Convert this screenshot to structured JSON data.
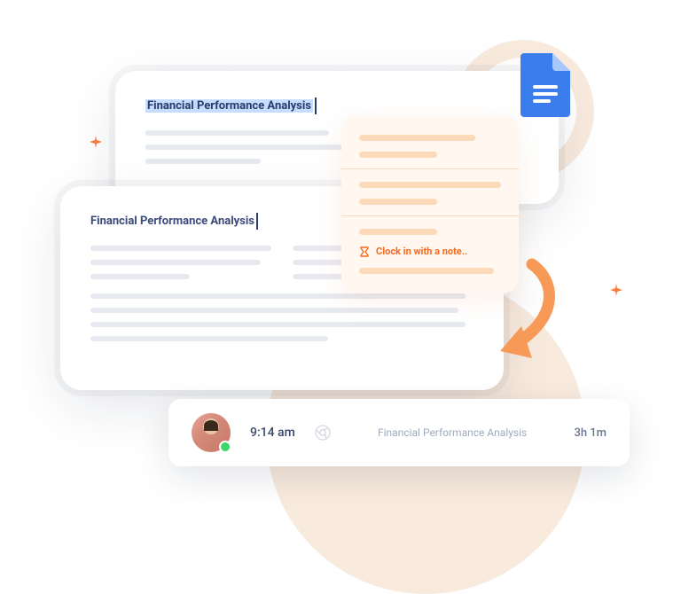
{
  "document_back": {
    "title": "Financial Performance Analysis"
  },
  "document_front": {
    "title": "Financial Performance Analysis"
  },
  "popup": {
    "clock_in_label": "Clock in with a note.."
  },
  "bar": {
    "time": "9:14 am",
    "task_name": "Financial Performance Analysis",
    "duration": "3h 1m"
  },
  "icons": {
    "docs": "google-docs-icon",
    "chrome": "chrome-icon",
    "hourglass": "hourglass-icon"
  },
  "colors": {
    "accent_orange": "#f56a1e",
    "soft_orange": "#f8eadd",
    "line_gray": "#e6e9f0",
    "docs_blue": "#3b7ded"
  }
}
